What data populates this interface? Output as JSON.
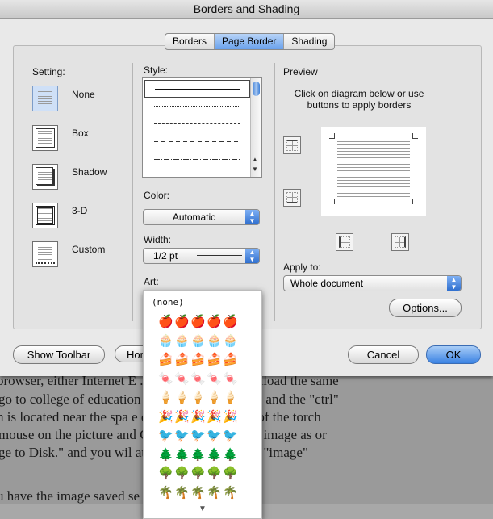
{
  "window": {
    "title": "Borders and Shading"
  },
  "tabs": [
    {
      "label": "Borders",
      "active": false
    },
    {
      "label": "Page Border",
      "active": true
    },
    {
      "label": "Shading",
      "active": false
    }
  ],
  "setting": {
    "label": "Setting:",
    "options": [
      {
        "label": "None",
        "selected": true
      },
      {
        "label": "Box",
        "selected": false
      },
      {
        "label": "Shadow",
        "selected": false
      },
      {
        "label": "3-D",
        "selected": false
      },
      {
        "label": "Custom",
        "selected": false
      }
    ]
  },
  "style": {
    "label": "Style:",
    "lines": [
      "solid",
      "dotted",
      "dashed",
      "dashed-long",
      "dash-dot"
    ],
    "selected_index": 0
  },
  "color": {
    "label": "Color:",
    "value": "Automatic"
  },
  "width": {
    "label": "Width:",
    "value": "1/2 pt"
  },
  "art": {
    "label": "Art:",
    "none_option": "(none)",
    "rows": [
      {
        "icon": "apple-art-icon",
        "glyph": "🍎",
        "color": "#c0181b"
      },
      {
        "icon": "cake-slice-art-icon",
        "glyph": "🧁",
        "color": "#8b4a12"
      },
      {
        "icon": "layer-cake-art-icon",
        "glyph": "🍰",
        "color": "#5a1f5f"
      },
      {
        "icon": "candy-corn-art-icon",
        "glyph": "🍬",
        "color": "#e07b10"
      },
      {
        "icon": "ice-cream-cone-art-icon",
        "glyph": "🍦",
        "color": "#c98a3a"
      },
      {
        "icon": "party-hat-art-icon",
        "glyph": "🎉",
        "color": "#7aa51c"
      },
      {
        "icon": "parrot-art-icon",
        "glyph": "🐦",
        "color": "#8b1a1a"
      },
      {
        "icon": "pine-tree-art-icon",
        "glyph": "🌲",
        "color": "#1a8a2a"
      },
      {
        "icon": "evergreen-art-icon",
        "glyph": "🌳",
        "color": "#1e5a24"
      },
      {
        "icon": "palm-tree-art-icon",
        "glyph": "🌴",
        "color": "#6b4a1a"
      }
    ]
  },
  "preview": {
    "label": "Preview",
    "instructions": "Click on diagram below or use buttons to apply borders"
  },
  "apply_to": {
    "label": "Apply to:",
    "value": "Whole document"
  },
  "buttons": {
    "options": "Options...",
    "show_toolbar": "Show Toolbar",
    "horizontal_line": "Hor",
    "cancel": "Cancel",
    "ok": "OK"
  },
  "background_document": {
    "lines": [
      "browser, either Internet E                    . So that we will download the same",
      "go to college of education                    nload the torch. Press and the \"ctrl\"",
      "h is located near the spa                     e cursor on the picture of the torch",
      "mouse on the picture and                       Choose the \"Save this image as or",
      "ge to Disk.\" and you wil                       ate and save this in the \"image\"",
      "",
      "u have the image saved                        se your image onto your"
    ]
  }
}
